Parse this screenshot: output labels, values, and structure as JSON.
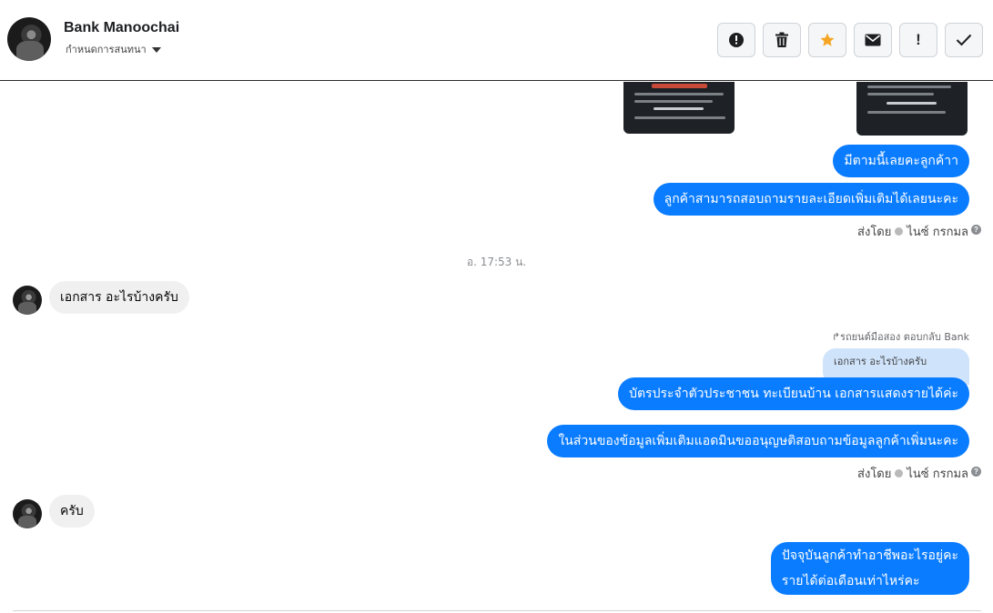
{
  "header": {
    "name": "Bank Manoochai",
    "subtitle": "กำหนดการสนทนา",
    "actions": [
      {
        "icon": "alert-circle-icon",
        "label": ""
      },
      {
        "icon": "trash-icon",
        "label": ""
      },
      {
        "icon": "star-icon",
        "label": "",
        "color": "#f5a623"
      },
      {
        "icon": "envelope-icon",
        "label": ""
      },
      {
        "icon": "exclamation-icon",
        "label": "!"
      },
      {
        "icon": "check-icon",
        "label": ""
      }
    ]
  },
  "thread": {
    "messages_top": [
      {
        "text": "มีตามนี้เลยคะลูกค้าา"
      },
      {
        "text": "ลูกค้าสามารถสอบถามรายละเอียดเพิ่มเติมได้เลยนะคะ"
      }
    ],
    "sent_by_1": {
      "prefix": "ส่งโดย",
      "name": "ไนซ์ กรกมล",
      "help": "?"
    },
    "timestamp": "อ. 17:53 น.",
    "incoming_1": "เอกสาร อะไรบ้างครับ",
    "reply_meta": "รถยนต์มือสอง ตอบกลับ Bank",
    "quoted_text": "เอกสาร อะไรบ้างครับ",
    "messages_mid": [
      {
        "text": "บัตรประจำตัวประชาชน ทะเบียนบ้าน เอกสารแสดงรายได้ค่ะ"
      },
      {
        "text": "ในส่วนของข้อมูลเพิ่มเติมแอดมินขออนุญษติสอบถามข้อมูลลูกค้าเพิ่มนะคะ"
      }
    ],
    "sent_by_2": {
      "prefix": "ส่งโดย",
      "name": "ไนซ์ กรกมล",
      "help": "?"
    },
    "incoming_2": "ครับ",
    "last_message": {
      "line1": "ปัจจุบันลูกค้าทำอาชีพอะไรอยู่คะ",
      "line2": "รายได้ต่อเดือนเท่าไหร่คะ"
    }
  },
  "colors": {
    "outgoing_bubble": "#0a7cff",
    "incoming_bubble": "#f0f0f0",
    "reply_bubble": "#cfe3fb",
    "star": "#f5a623"
  }
}
